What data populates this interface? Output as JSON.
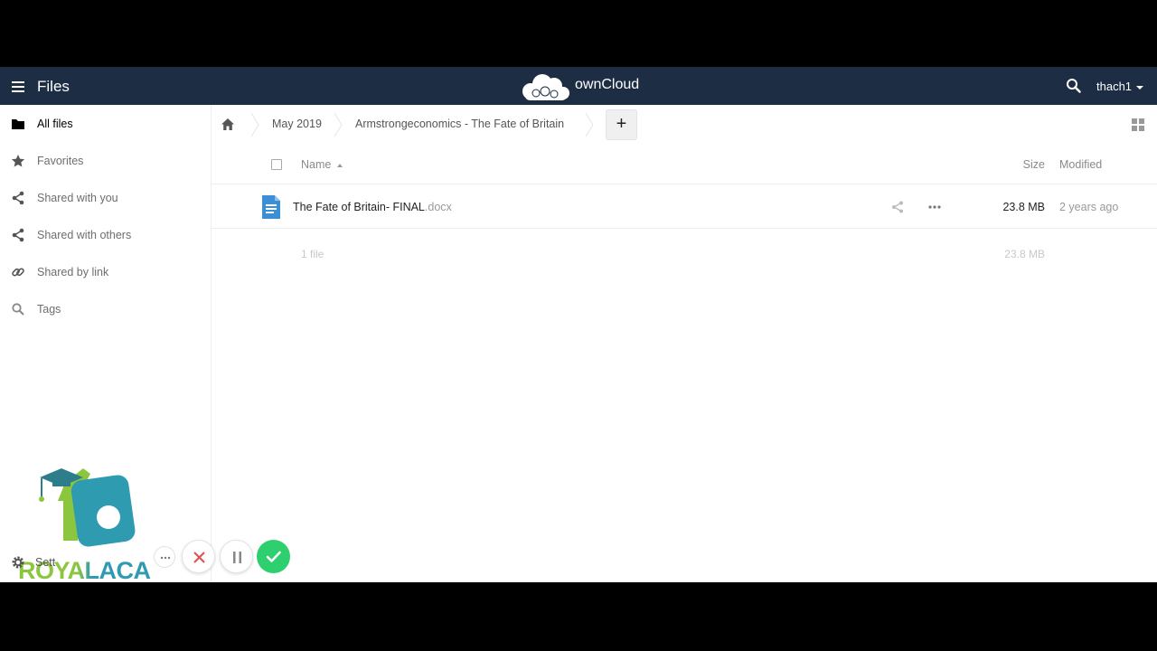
{
  "header": {
    "app_title": "Files",
    "brand": "ownCloud",
    "user": "thach1"
  },
  "sidebar": {
    "items": [
      {
        "label": "All files",
        "icon": "folder-icon",
        "active": true
      },
      {
        "label": "Favorites",
        "icon": "star-icon"
      },
      {
        "label": "Shared with you",
        "icon": "share-icon"
      },
      {
        "label": "Shared with others",
        "icon": "share-icon"
      },
      {
        "label": "Shared by link",
        "icon": "link-icon"
      },
      {
        "label": "Tags",
        "icon": "search-icon"
      }
    ],
    "settings_label": "Sett"
  },
  "breadcrumb": {
    "items": [
      "May 2019",
      "Armstrongeconomics - The Fate of Britain"
    ],
    "add_label": "+"
  },
  "table": {
    "columns": {
      "name": "Name",
      "size": "Size",
      "modified": "Modified"
    },
    "rows": [
      {
        "name": "The Fate of Britain- FINAL",
        "ext": ".docx",
        "size": "23.8 MB",
        "modified": "2 years ago"
      }
    ],
    "summary": {
      "count": "1 file",
      "size": "23.8 MB"
    }
  },
  "watermark": {
    "text": "ROYALACA"
  },
  "colors": {
    "header_bg": "#1d2d44",
    "accent_blue": "#3a8fd6",
    "ok_green": "#2ecf6e",
    "close_red": "#e05050",
    "wm_green": "#8cc63f",
    "wm_teal": "#2e9bb0"
  }
}
